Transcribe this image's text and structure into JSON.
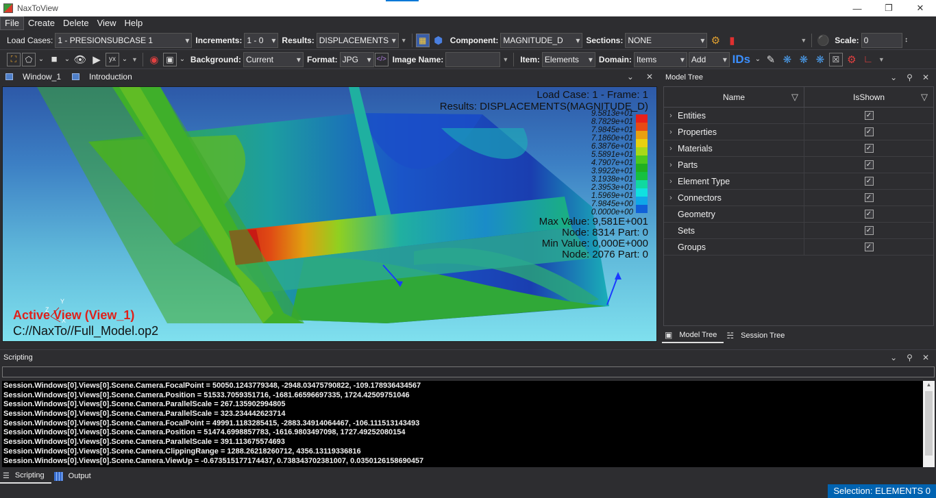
{
  "window": {
    "title": "NaxToView",
    "minimize": "—",
    "maximize": "❐",
    "close": "✕"
  },
  "menu": [
    "File",
    "Create",
    "Delete",
    "View",
    "Help"
  ],
  "toolbar1": {
    "load_cases_label": "Load Cases:",
    "load_cases_value": "1 -  PRESIONSUBCASE  1",
    "increments_label": "Increments:",
    "increments_value": "1 - 0",
    "results_label": "Results:",
    "results_value": "DISPLACEMENTS",
    "component_label": "Component:",
    "component_value": "MAGNITUDE_D",
    "sections_label": "Sections:",
    "sections_value": "NONE",
    "scale_label": "Scale:",
    "scale_value": "0"
  },
  "toolbar2": {
    "background_label": "Background:",
    "background_value": "Current",
    "format_label": "Format:",
    "format_value": "JPG",
    "image_name_label": "Image Name:",
    "image_name_value": "",
    "item_label": "Item:",
    "item_value": "Elements",
    "domain_label": "Domain:",
    "domain_value": "Items",
    "add_value": "Add",
    "ids_label": "IDs"
  },
  "doc_tabs": [
    "Window_1",
    "Introduction"
  ],
  "viewport": {
    "load_case": "Load Case: 1 - Frame: 1",
    "results": "Results: DISPLACEMENTS(MAGNITUDE_D)",
    "legend": {
      "labels": [
        "9.5813e+01",
        "8.7829e+01",
        "7.9845e+01",
        "7.1860e+01",
        "6.3876e+01",
        "5.5891e+01",
        "4.7907e+01",
        "3.9922e+01",
        "3.1938e+01",
        "2.3953e+01",
        "1.5969e+01",
        "7.9845e+00",
        "0.0000e+00"
      ],
      "colors": [
        "#e8201a",
        "#e84a14",
        "#e8a010",
        "#e8d010",
        "#a8d818",
        "#4cc81e",
        "#20b020",
        "#16c040",
        "#10d8a0",
        "#10e0e0",
        "#10a8e8",
        "#1060d8",
        "#1030b8"
      ]
    },
    "max_value": "Max Value: 9,581E+001",
    "max_node": "Node: 8314 Part: 0",
    "min_value": "Min Value: 0,000E+000",
    "min_node": "Node: 2076 Part: 0",
    "active_view": "Active View (View_1)",
    "file_path": "C://NaxTo//Full_Model.op2",
    "axis_y": "Y",
    "axis_z": "Z",
    "axis_x": "X"
  },
  "model_tree": {
    "title": "Model Tree",
    "col_name": "Name",
    "col_shown": "IsShown",
    "rows": [
      {
        "name": "Entities",
        "expandable": true
      },
      {
        "name": "Properties",
        "expandable": true
      },
      {
        "name": "Materials",
        "expandable": true
      },
      {
        "name": "Parts",
        "expandable": true
      },
      {
        "name": "Element Type",
        "expandable": true
      },
      {
        "name": "Connectors",
        "expandable": true
      },
      {
        "name": "Geometry",
        "expandable": false
      },
      {
        "name": "Sets",
        "expandable": false
      },
      {
        "name": "Groups",
        "expandable": false
      }
    ],
    "tabs": [
      "Model Tree",
      "Session Tree"
    ]
  },
  "scripting": {
    "title": "Scripting",
    "lines": [
      "Session.Windows[0].Views[0].Scene.Camera.FocalPoint = 50050.1243779348, -2948.03475790822, -109.178936434567",
      "Session.Windows[0].Views[0].Scene.Camera.Position = 51533.7059351716, -1681.66596697335, 1724.42509751046",
      "Session.Windows[0].Views[0].Scene.Camera.ParallelScale = 267.135902994805",
      "Session.Windows[0].Views[0].Scene.Camera.ParallelScale = 323.234442623714",
      "Session.Windows[0].Views[0].Scene.Camera.FocalPoint = 49991.1183285415, -2883.34914064467, -106.111513143493",
      "Session.Windows[0].Views[0].Scene.Camera.Position = 51474.6998857783, -1616.9803497098, 1727.49252080154",
      "Session.Windows[0].Views[0].Scene.Camera.ParallelScale = 391.113675574693",
      "Session.Windows[0].Views[0].Scene.Camera.ClippingRange = 1288.26218260712, 4356.13119336816",
      "Session.Windows[0].Views[0].Scene.Camera.ViewUp = -0.673515177174437, 0.738343702381007, 0.0350126158690457"
    ],
    "tabs": [
      "Scripting",
      "Output"
    ]
  },
  "status": {
    "selection": "Selection:  ELEMENTS   0"
  }
}
